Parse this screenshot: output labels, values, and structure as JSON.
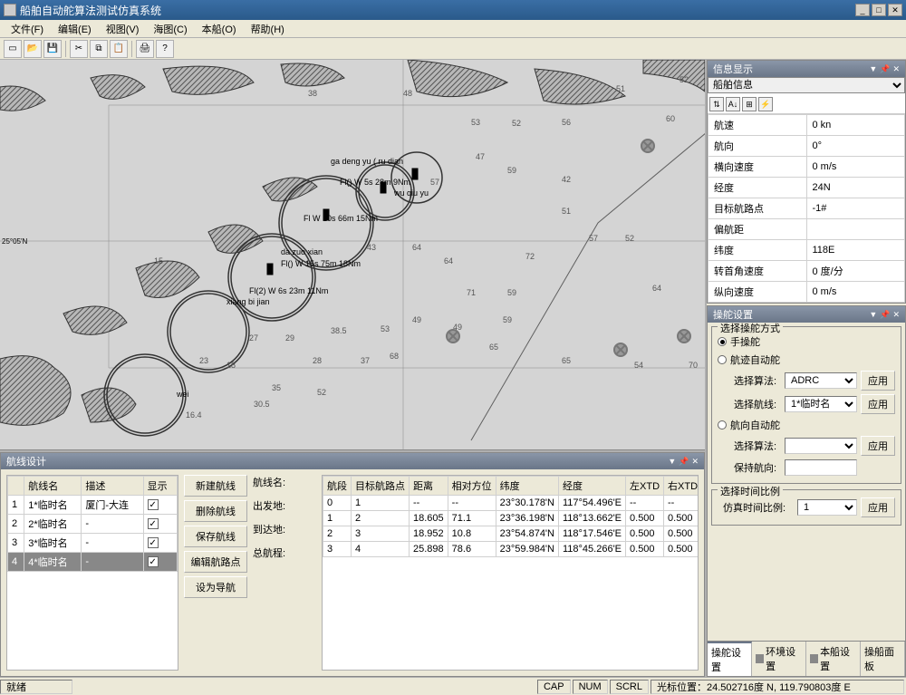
{
  "titlebar": {
    "title": "船舶自动舵算法测试仿真系统"
  },
  "winbtns": {
    "min": "_",
    "max": "□",
    "close": "✕"
  },
  "menus": {
    "file": "文件(F)",
    "edit": "编辑(E)",
    "view": "视图(V)",
    "chart": "海图(C)",
    "own": "本船(O)",
    "help": "帮助(H)"
  },
  "chart_annotations": {
    "a": "ga deng yu ( ru dian",
    "b": "Fl() W 5s 28m 9Nm",
    "c": "wu qiu yu",
    "d": "Fl W 10s 66m 15Nm",
    "e": "da zuo xian",
    "f": "Fl() W 15s 75m 18Nm",
    "g": "Fl(2) W 6s 23m 11Nm",
    "h": "xiang bi jian",
    "i": "wei",
    "lat": "25°05'N"
  },
  "chart_depths": [
    "38",
    "48",
    "53",
    "52",
    "56",
    "51",
    "60",
    "52",
    "57",
    "47",
    "59",
    "42",
    "51",
    "43",
    "64",
    "64",
    "72",
    "57",
    "52",
    "71",
    "59",
    "59",
    "49",
    "49",
    "64",
    "53",
    "68",
    "65",
    "65",
    "54",
    "70",
    "27",
    "29",
    "38.5",
    "28",
    "37",
    "16.4",
    "30.5",
    "18",
    "15",
    "23",
    "35",
    "52"
  ],
  "info_panel": {
    "title": "信息显示",
    "dropdown": "船舶信息",
    "rows": [
      {
        "k": "航速",
        "v": "0 kn"
      },
      {
        "k": "航向",
        "v": "0°"
      },
      {
        "k": "横向速度",
        "v": "0 m/s"
      },
      {
        "k": "经度",
        "v": "24N"
      },
      {
        "k": "目标航路点",
        "v": "-1#"
      },
      {
        "k": "偏航距",
        "v": ""
      },
      {
        "k": "纬度",
        "v": "118E"
      },
      {
        "k": "转首角速度",
        "v": "0 度/分"
      },
      {
        "k": "纵向速度",
        "v": "0 m/s"
      }
    ]
  },
  "steer_panel": {
    "title": "操舵设置",
    "group_mode": "选择操舵方式",
    "mode_manual": "手操舵",
    "mode_track": "航迹自动舵",
    "sel_algo_label": "选择算法:",
    "sel_algo_value": "ADRC",
    "sel_route_label": "选择航线:",
    "sel_route_value": "1*临时名",
    "mode_heading": "航向自动舵",
    "sel_algo2_label": "选择算法:",
    "keep_heading": "保持航向:",
    "apply": "应用",
    "group_time": "选择时间比例",
    "time_label": "仿真时间比例:",
    "time_value": "1"
  },
  "tabs": {
    "t1": "操舵设置",
    "t2": "环境设置",
    "t3": "本船设置",
    "t4": "操船面板"
  },
  "route_design": {
    "title": "航线设计",
    "list_headers": {
      "name": "航线名",
      "desc": "描述",
      "show": "显示"
    },
    "list": [
      {
        "idx": "1",
        "name": "1*临时名",
        "desc": "厦门-大连",
        "show": true
      },
      {
        "idx": "2",
        "name": "2*临时名",
        "desc": "-",
        "show": true
      },
      {
        "idx": "3",
        "name": "3*临时名",
        "desc": "-",
        "show": true
      },
      {
        "idx": "4",
        "name": "4*临时名",
        "desc": "-",
        "show": true,
        "selected": true
      }
    ],
    "btns": {
      "new": "新建航线",
      "del": "删除航线",
      "save": "保存航线",
      "edit": "编辑航路点",
      "nav": "设为导航"
    },
    "fields": {
      "name": "航线名:",
      "from": "出发地:",
      "to": "到达地:",
      "total": "总航程:"
    },
    "seg_headers": {
      "seg": "航段",
      "tgt": "目标航路点",
      "dist": "距离",
      "brg": "相对方位",
      "lat": "纬度",
      "lon": "经度",
      "lxtd": "左XTD",
      "rxtd": "右XTD"
    },
    "segments": [
      {
        "seg": "0",
        "tgt": "1",
        "dist": "--",
        "brg": "--",
        "lat": "23°30.178'N",
        "lon": "117°54.496'E",
        "lxtd": "--",
        "rxtd": "--"
      },
      {
        "seg": "1",
        "tgt": "2",
        "dist": "18.605",
        "brg": "71.1",
        "lat": "23°36.198'N",
        "lon": "118°13.662'E",
        "lxtd": "0.500",
        "rxtd": "0.500"
      },
      {
        "seg": "2",
        "tgt": "3",
        "dist": "18.952",
        "brg": "10.8",
        "lat": "23°54.874'N",
        "lon": "118°17.546'E",
        "lxtd": "0.500",
        "rxtd": "0.500"
      },
      {
        "seg": "3",
        "tgt": "4",
        "dist": "25.898",
        "brg": "78.6",
        "lat": "23°59.984'N",
        "lon": "118°45.266'E",
        "lxtd": "0.500",
        "rxtd": "0.500"
      }
    ]
  },
  "statusbar": {
    "ready": "就绪",
    "cap": "CAP",
    "num": "NUM",
    "scrl": "SCRL",
    "cursor": "光标位置：24.502716度 N, 119.790803度 E"
  }
}
